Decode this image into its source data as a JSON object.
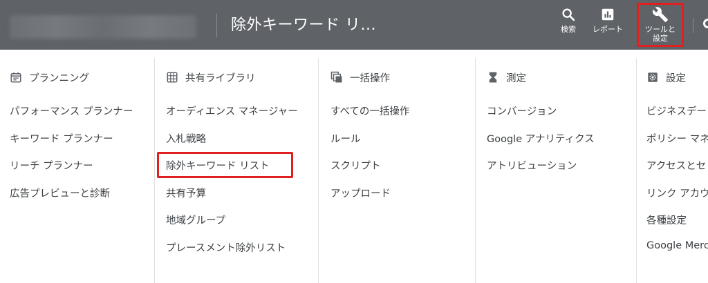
{
  "header": {
    "title": "除外キーワード リ...",
    "tools": [
      {
        "label": "検索",
        "icon": "search-icon"
      },
      {
        "label": "レポート",
        "icon": "bar-chart-icon"
      },
      {
        "label_line1": "ツールと",
        "label_line2": "設定",
        "icon": "wrench-icon"
      }
    ],
    "accent_color": "#e02020"
  },
  "columns": [
    {
      "heading": "プランニング",
      "icon": "calendar-icon",
      "items": [
        "パフォーマンス プランナー",
        "キーワード プランナー",
        "リーチ プランナー",
        "広告プレビューと診断"
      ]
    },
    {
      "heading": "共有ライブラリ",
      "icon": "grid-library-icon",
      "items": [
        "オーディエンス マネージャー",
        "入札戦略",
        "除外キーワード リスト",
        "共有予算",
        "地域グループ",
        "プレースメント除外リスト"
      ]
    },
    {
      "heading": "一括操作",
      "icon": "bulk-copy-icon",
      "items": [
        "すべての一括操作",
        "ルール",
        "スクリプト",
        "アップロード"
      ]
    },
    {
      "heading": "測定",
      "icon": "hourglass-icon",
      "items": [
        "コンバージョン",
        "Google アナリティクス",
        "アトリビューション"
      ]
    },
    {
      "heading": "設定",
      "icon": "gear-icon",
      "items": [
        "ビジネスデー",
        "ポリシー マネ",
        "アクセスとセ",
        "リンク アカウ",
        "各種設定",
        "Google Merch"
      ]
    }
  ]
}
